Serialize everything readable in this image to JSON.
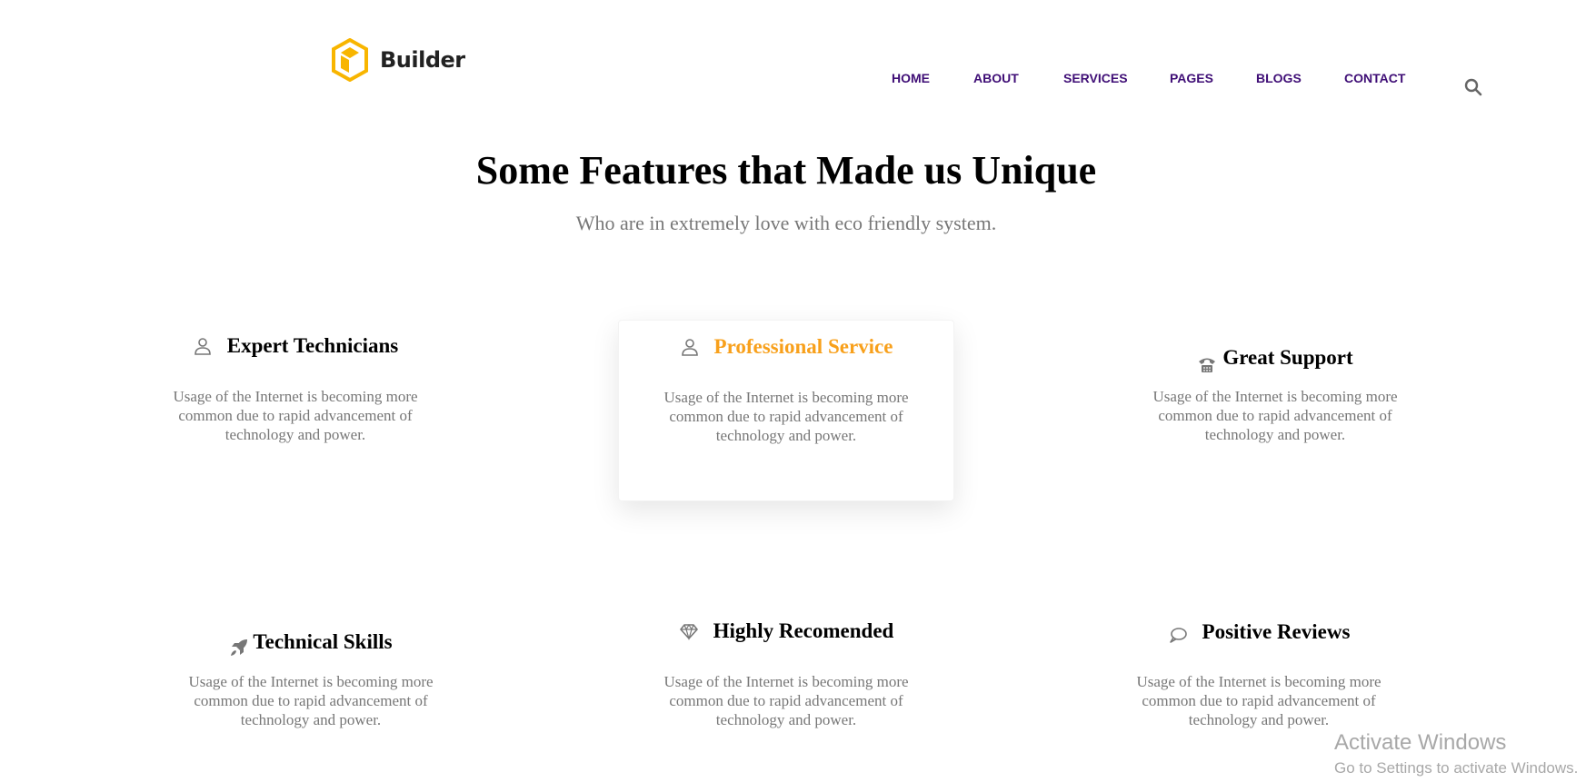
{
  "brand": {
    "name": "Builder",
    "accent": "#f8b500"
  },
  "nav": {
    "items": [
      "HOME",
      "ABOUT",
      "SERVICES",
      "PAGES",
      "BLOGS",
      "CONTACT"
    ],
    "color": "#3f0e76"
  },
  "section": {
    "title": "Some Features that Made us Unique",
    "subtitle": "Who are in extremely love with eco friendly system."
  },
  "features": [
    {
      "icon": "user-icon",
      "title": "Expert Technicians",
      "text": "Usage of the Internet is becoming more common due to rapid advancement of technology and power."
    },
    {
      "icon": "user-icon",
      "title": "Professional Service",
      "text": "Usage of the Internet is becoming more common due to rapid advancement of technology and power.",
      "highlighted": true
    },
    {
      "icon": "phone-icon",
      "title": "Great Support",
      "text": "Usage of the Internet is becoming more common due to rapid advancement of technology and power."
    },
    {
      "icon": "rocket-icon",
      "title": "Technical Skills",
      "text": "Usage of the Internet is becoming more common due to rapid advancement of technology and power."
    },
    {
      "icon": "diamond-icon",
      "title": "Highly Recomended",
      "text": "Usage of the Internet is becoming more common due to rapid advancement of technology and power."
    },
    {
      "icon": "chat-bubble-icon",
      "title": "Positive Reviews",
      "text": "Usage of the Internet is becoming more common due to rapid advancement of technology and power."
    }
  ],
  "highlight_color": "#f8a01b",
  "watermark": {
    "title": "Activate Windows",
    "subtitle": "Go to Settings to activate Windows."
  }
}
